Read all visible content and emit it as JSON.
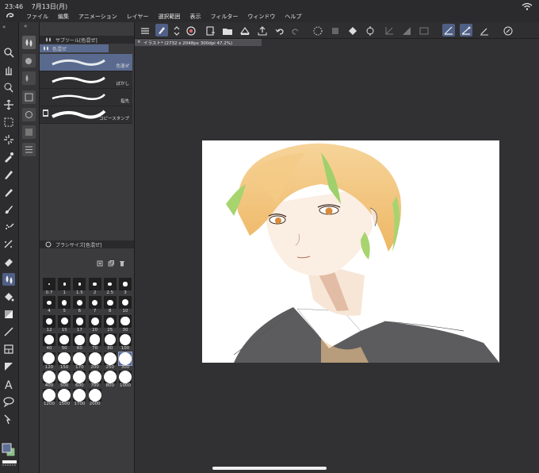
{
  "status": {
    "time": "23:46",
    "date": "7月13日(月)"
  },
  "menu": [
    "ファイル",
    "編集",
    "アニメーション",
    "レイヤー",
    "選択範囲",
    "表示",
    "フィルター",
    "ウィンドウ",
    "ヘルプ"
  ],
  "subtool_panel": {
    "title": "サブツール[色混ぜ]",
    "group": "色混ぜ",
    "items": [
      {
        "name": "色混ぜ",
        "selected": true
      },
      {
        "name": "ぼかし",
        "selected": false
      },
      {
        "name": "指先",
        "selected": false
      },
      {
        "name": "コピースタンプ",
        "selected": false
      }
    ]
  },
  "brush_size_panel": {
    "title": "ブラシサイズ[色混ぜ]",
    "sizes": [
      "0.7",
      "1",
      "1.5",
      "2",
      "2.5",
      "3",
      "4",
      "5",
      "6",
      "7",
      "8",
      "10",
      "12",
      "15",
      "17",
      "20",
      "25",
      "30",
      "40",
      "50",
      "60",
      "70",
      "80",
      "100",
      "120",
      "150",
      "170",
      "200",
      "250",
      "300",
      "400",
      "500",
      "600",
      "700",
      "800",
      "1000",
      "1200",
      "1500",
      "1700",
      "2000"
    ],
    "selected": "300"
  },
  "document": {
    "tab_label": "イラスト* (2732 x 2048px 300dpi 47.2%)"
  },
  "colors": {
    "main": "#5d6f95",
    "sub": "#8ebf8a",
    "accent": "#4f5f86"
  }
}
